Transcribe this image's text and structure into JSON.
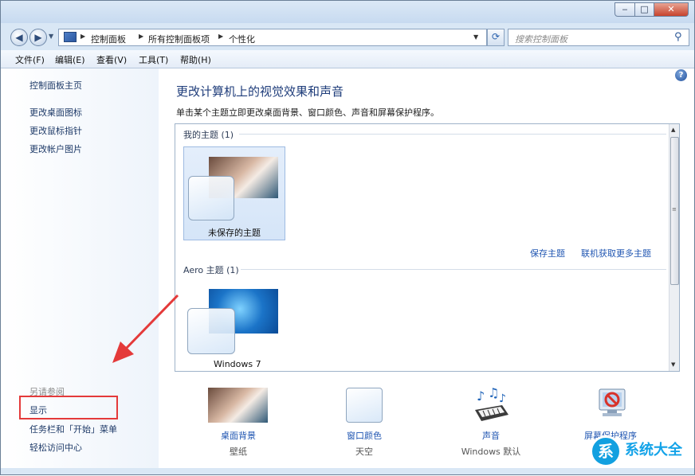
{
  "window": {
    "minimize_glyph": "‒",
    "maximize_glyph": "□",
    "close_glyph": "✕"
  },
  "address_bar": {
    "crumbs": [
      "控制面板",
      "所有控制面板项",
      "个性化"
    ],
    "search_placeholder": "搜索控制面板"
  },
  "menu": [
    "文件(F)",
    "编辑(E)",
    "查看(V)",
    "工具(T)",
    "帮助(H)"
  ],
  "sidebar": {
    "home": "控制面板主页",
    "tasks": [
      "更改桌面图标",
      "更改鼠标指针",
      "更改帐户图片"
    ],
    "see_also_title": "另请参阅",
    "see_also": [
      "显示",
      "任务栏和「开始」菜单",
      "轻松访问中心"
    ]
  },
  "main": {
    "heading": "更改计算机上的视觉效果和声音",
    "subtitle": "单击某个主题立即更改桌面背景、窗口颜色、声音和屏幕保护程序。",
    "my_themes": {
      "title": "我的主题 (1)",
      "items": [
        {
          "label": "未保存的主题"
        }
      ]
    },
    "actions": [
      "保存主题",
      "联机获取更多主题"
    ],
    "aero_themes": {
      "title": "Aero 主题 (1)",
      "items": [
        {
          "label": "Windows 7"
        }
      ]
    },
    "bottom": [
      {
        "caption": "桌面背景",
        "value": "壁纸",
        "icon": "desktop-background-icon"
      },
      {
        "caption": "窗口颜色",
        "value": "天空",
        "icon": "window-color-icon"
      },
      {
        "caption": "声音",
        "value": "Windows 默认",
        "icon": "sound-icon"
      },
      {
        "caption": "屏幕保护程序",
        "value": "",
        "icon": "screensaver-icon"
      }
    ]
  },
  "watermark": {
    "logo_char": "系",
    "text": "系统大全"
  },
  "colors": {
    "link": "#2056b2",
    "heading": "#1e3c7a",
    "highlight_box": "#e43a3a",
    "annotation_arrow": "#e43a3a",
    "watermark": "#14a3e8"
  }
}
